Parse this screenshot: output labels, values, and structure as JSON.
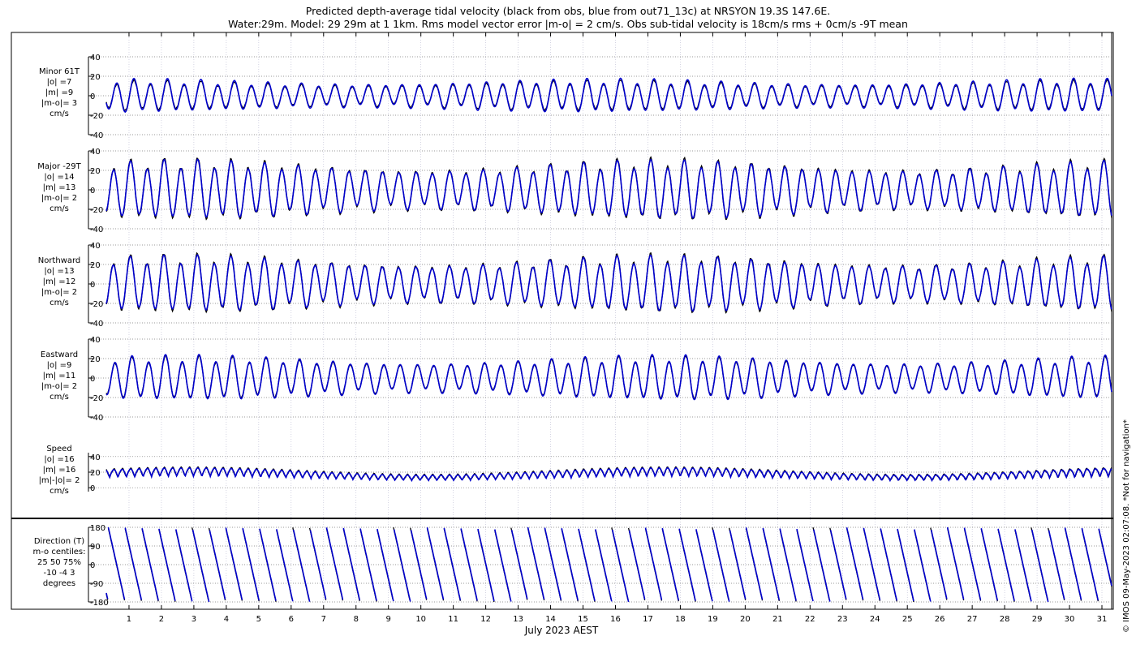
{
  "title_line1": "Predicted depth-average tidal velocity (black from obs, blue from out71_13c) at NRSYON 19.3S 147.6E.",
  "title_line2": "Water:29m. Model: 29 29m at 1 1km. Rms model vector error |m-o| = 2 cm/s. Obs sub-tidal velocity is 18cm/s rms + 0cm/s -9T mean",
  "copyright": "© IMOS 09-May-2023 02:07:08. *Not for navigation*",
  "colors": {
    "obs": "#000000",
    "model": "#0000cc",
    "grid": "#999999"
  },
  "chart_data": {
    "type": "line",
    "x": {
      "label": "July 2023 AEST",
      "range": [
        "2023-07-01T00:00",
        "2023-07-32T06:00"
      ],
      "ticks": [
        "1",
        "2",
        "3",
        "4",
        "5",
        "6",
        "7",
        "8",
        "9",
        "10",
        "11",
        "12",
        "13",
        "14",
        "15",
        "16",
        "17",
        "18",
        "19",
        "20",
        "21",
        "22",
        "23",
        "24",
        "25",
        "26",
        "27",
        "28",
        "29",
        "30",
        "31"
      ],
      "sample_hours": 0.5
    },
    "panels": [
      {
        "id": "minor",
        "labels": [
          "Minor 61T",
          "|o| =7",
          "|m| =9",
          "|m-o|= 3",
          "cm/s"
        ],
        "yticks": [
          "40",
          "20",
          "0",
          "-20",
          "-40"
        ],
        "ylim": [
          -40,
          40
        ],
        "type": "sine",
        "base_amp": 13,
        "amp_mod": 0.35,
        "lowest_day": 23,
        "phase": 0.2,
        "series": [
          {
            "name": "obs",
            "amp_scale": 0.9
          },
          {
            "name": "model",
            "amp_scale": 1.0
          }
        ]
      },
      {
        "id": "major",
        "labels": [
          "Major -29T",
          "|o| =14",
          "|m| =13",
          "|m-o|= 2",
          "cm/s"
        ],
        "yticks": [
          "40",
          "20",
          "0",
          "-20",
          "-40"
        ],
        "ylim": [
          -40,
          40
        ],
        "type": "sine",
        "base_amp": 22,
        "amp_mod": 0.42,
        "lowest_day": 25,
        "phase": 1.4,
        "series": [
          {
            "name": "obs",
            "amp_scale": 1.05
          },
          {
            "name": "model",
            "amp_scale": 1.0
          }
        ]
      },
      {
        "id": "north",
        "labels": [
          "Northward",
          "|o| =13",
          "|m| =12",
          "|m-o|= 2",
          "cm/s"
        ],
        "yticks": [
          "40",
          "20",
          "0",
          "-20",
          "-40"
        ],
        "ylim": [
          -40,
          40
        ],
        "type": "sine",
        "base_amp": 21,
        "amp_mod": 0.42,
        "lowest_day": 25,
        "phase": 1.5,
        "series": [
          {
            "name": "obs",
            "amp_scale": 1.05
          },
          {
            "name": "model",
            "amp_scale": 1.0
          }
        ]
      },
      {
        "id": "east",
        "labels": [
          "Eastward",
          "|o| =9",
          "|m| =11",
          "|m-o|= 2",
          "cm/s"
        ],
        "yticks": [
          "40",
          "20",
          "0",
          "-20",
          "-40"
        ],
        "ylim": [
          -40,
          40
        ],
        "type": "sine",
        "base_amp": 17,
        "amp_mod": 0.42,
        "lowest_day": 25,
        "phase": 0.9,
        "series": [
          {
            "name": "obs",
            "amp_scale": 0.95
          },
          {
            "name": "model",
            "amp_scale": 1.0
          }
        ]
      },
      {
        "id": "speed",
        "labels": [
          "Speed",
          "|o| =16",
          "|m| =16",
          "|m|-|o|= 2",
          "cm/s"
        ],
        "yticks": [
          "40",
          "20",
          "0"
        ],
        "ylim": [
          -5,
          45
        ],
        "type": "speed",
        "base_mean": 18,
        "base_amp": 9,
        "amp_mod": 0.45,
        "lowest_day": 25,
        "phase": 1.4,
        "series": [
          {
            "name": "obs",
            "amp_scale": 1.05
          },
          {
            "name": "model",
            "amp_scale": 1.0
          }
        ]
      },
      {
        "id": "direction",
        "labels": [
          "Direction (T)",
          "m-o centiles:",
          "25  50  75%",
          "-10 -4  3",
          "degrees"
        ],
        "yticks": [
          "180",
          "90",
          "0",
          "-90",
          "-180"
        ],
        "ylim": [
          -180,
          180
        ],
        "type": "direction",
        "phase": 0.3,
        "series": [
          {
            "name": "obs"
          },
          {
            "name": "model"
          }
        ]
      }
    ]
  }
}
